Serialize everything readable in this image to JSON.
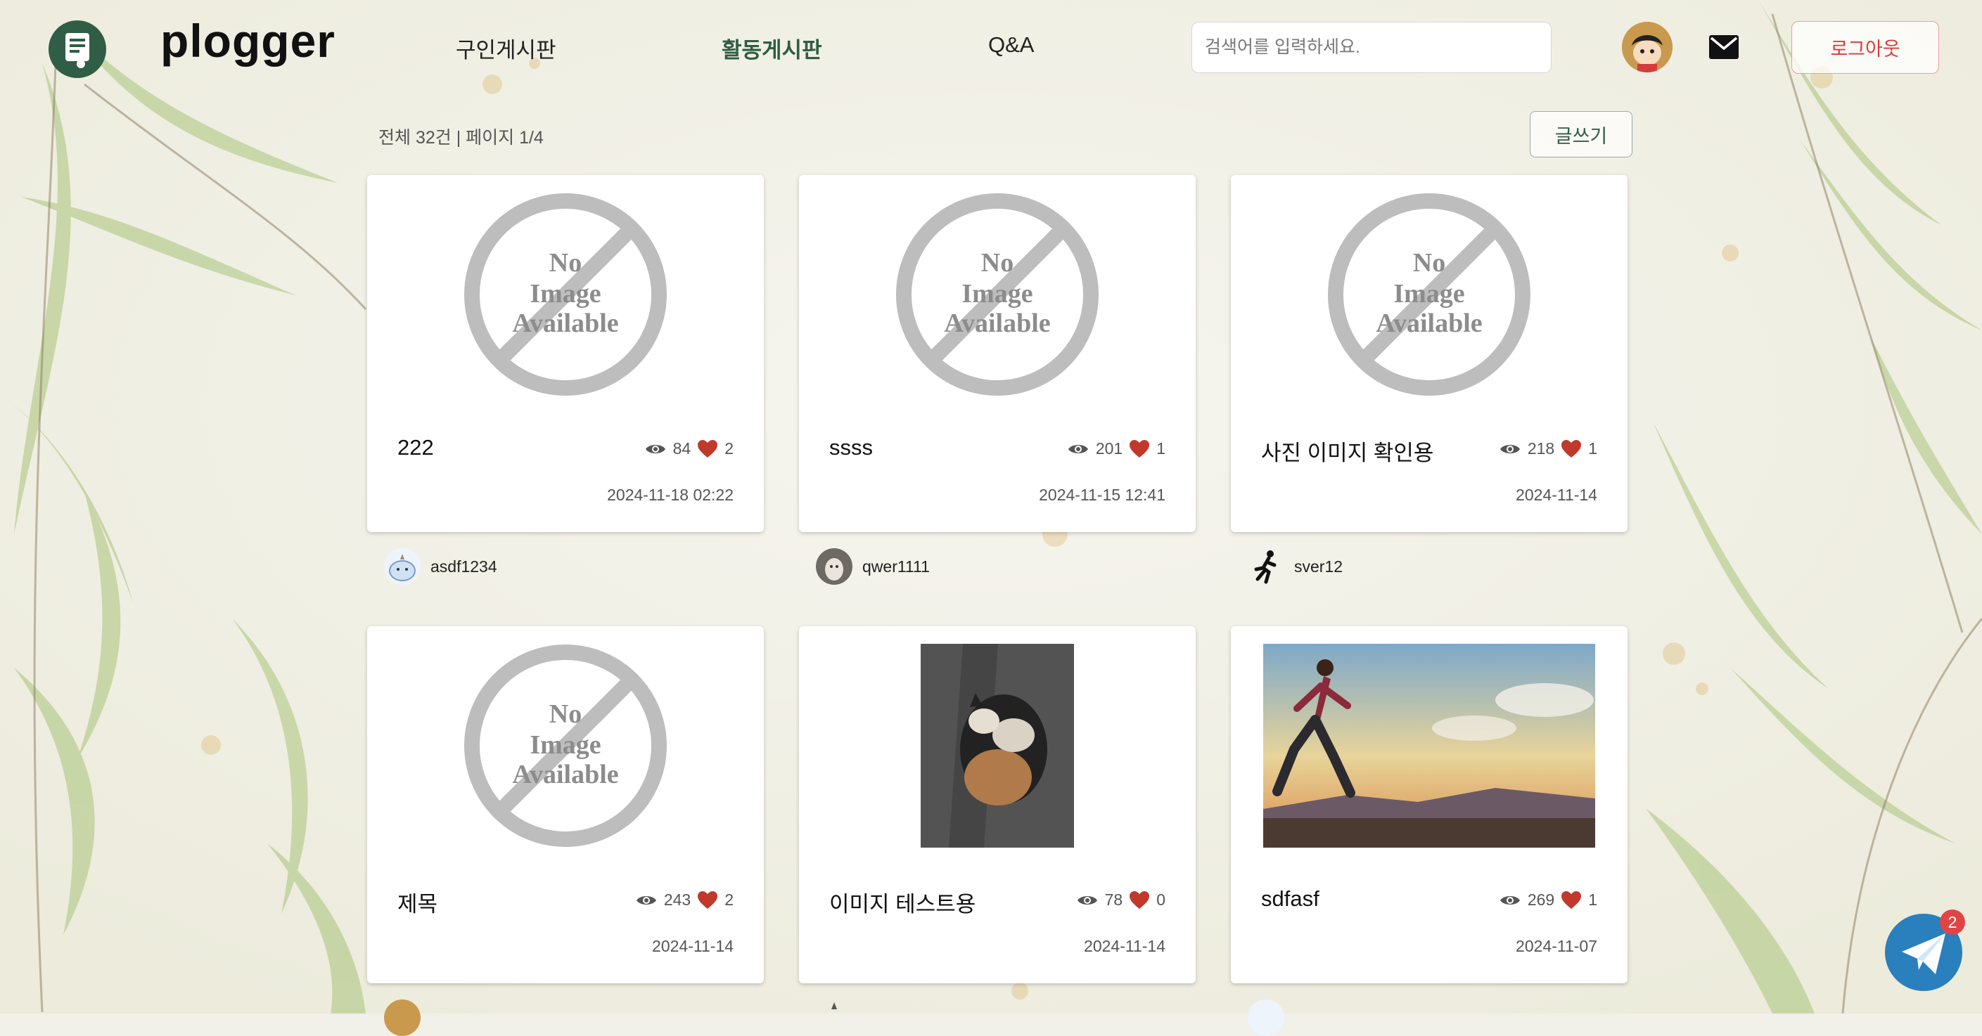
{
  "header": {
    "brand": "plogger",
    "nav": [
      "구인게시판",
      "활동게시판",
      "Q&A"
    ],
    "active_nav": "활동게시판",
    "search_placeholder": "검색어를 입력하세요.",
    "logout_label": "로그아웃"
  },
  "board": {
    "summary": "전체 32건 | 페이지 1/4",
    "write_label": "글쓰기"
  },
  "noimage_text": [
    "No",
    "Image",
    "Available"
  ],
  "posts": [
    {
      "title": "222",
      "views": "84",
      "likes": "2",
      "date": "2024-11-18 02:22",
      "author": "asdf1234",
      "image": "no-image"
    },
    {
      "title": "ssss",
      "views": "201",
      "likes": "1",
      "date": "2024-11-15 12:41",
      "author": "qwer1111",
      "image": "no-image"
    },
    {
      "title": "사진 이미지 확인용",
      "views": "218",
      "likes": "1",
      "date": "2024-11-14",
      "author": "sver12",
      "image": "no-image"
    },
    {
      "title": "제목",
      "views": "243",
      "likes": "2",
      "date": "2024-11-14",
      "author": "",
      "image": "no-image"
    },
    {
      "title": "이미지 테스트용",
      "views": "78",
      "likes": "0",
      "date": "2024-11-14",
      "author": "",
      "image": "cat-photo"
    },
    {
      "title": "sdfasf",
      "views": "269",
      "likes": "1",
      "date": "2024-11-07",
      "author": "",
      "image": "runner-photo"
    }
  ],
  "fab": {
    "badge": "2",
    "icon": "paper-plane-icon"
  },
  "colors": {
    "accent": "#2f5d45",
    "like": "#c0392b",
    "logout": "#e03a3a",
    "fab": "#2a7fbd"
  }
}
